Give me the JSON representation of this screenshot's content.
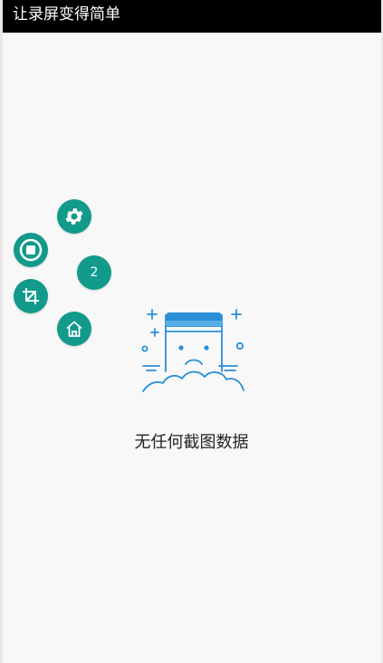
{
  "app": {
    "title": "让录屏变得简单"
  },
  "floating_menu": {
    "badge_count": "2",
    "items": [
      {
        "icon": "gear-icon"
      },
      {
        "icon": "stop-record-icon"
      },
      {
        "icon": "crop-icon"
      },
      {
        "icon": "home-icon"
      }
    ],
    "accent_color": "#129a8b"
  },
  "empty_state": {
    "icon": "sad-document-illustration",
    "message": "无任何截图数据",
    "illustration_color": "#2a8fd6"
  }
}
